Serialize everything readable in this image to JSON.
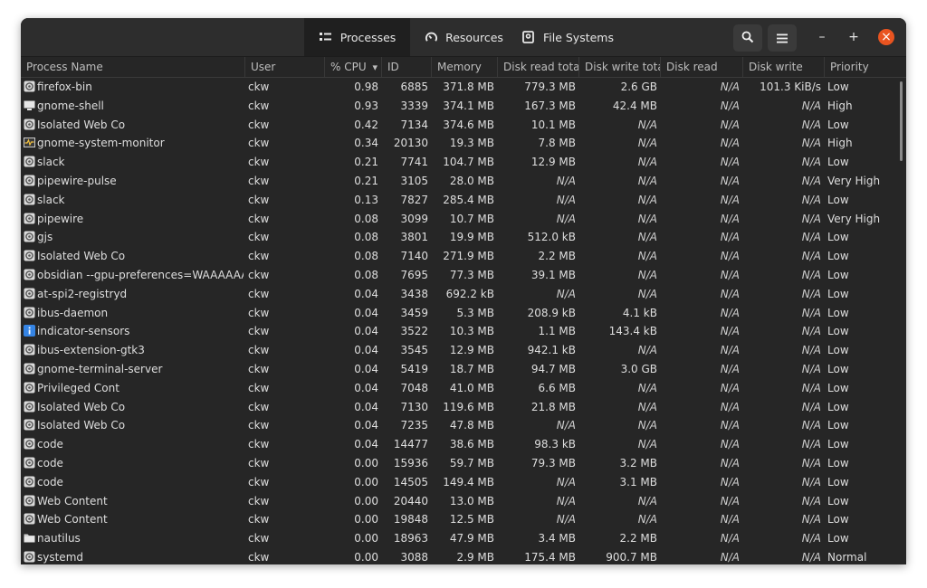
{
  "tabs": [
    {
      "label": "Processes",
      "icon": "list-icon",
      "active": true
    },
    {
      "label": "Resources",
      "icon": "gauge-icon",
      "active": false
    },
    {
      "label": "File Systems",
      "icon": "disk-icon",
      "active": false
    }
  ],
  "header_buttons": {
    "search": "search-icon",
    "menu": "hamburger-menu-icon",
    "minimize": "–",
    "maximize": "+",
    "close": "×"
  },
  "colors": {
    "accent_close": "#e95420",
    "background": "#262626",
    "header": "#2d2d2d"
  },
  "columns": [
    "Process Name",
    "User",
    "% CPU",
    "ID",
    "Memory",
    "Disk read total",
    "Disk write total",
    "Disk read",
    "Disk write",
    "Priority"
  ],
  "sort_indicator": "▾",
  "processes": [
    {
      "name": "firefox-bin",
      "icon": "generic",
      "user": "ckw",
      "cpu": "0.98",
      "id": "6885",
      "memory": "371.8 MB",
      "read_total": "779.3 MB",
      "write_total": "2.6 GB",
      "read": "N/A",
      "write": "101.3 KiB/s",
      "priority": "Low"
    },
    {
      "name": "gnome-shell",
      "icon": "shell",
      "user": "ckw",
      "cpu": "0.93",
      "id": "3339",
      "memory": "374.1 MB",
      "read_total": "167.3 MB",
      "write_total": "42.4 MB",
      "read": "N/A",
      "write": "N/A",
      "priority": "High"
    },
    {
      "name": "Isolated Web Co",
      "icon": "generic",
      "user": "ckw",
      "cpu": "0.42",
      "id": "7134",
      "memory": "374.6 MB",
      "read_total": "10.1 MB",
      "write_total": "N/A",
      "read": "N/A",
      "write": "N/A",
      "priority": "Low"
    },
    {
      "name": "gnome-system-monitor",
      "icon": "monitor",
      "user": "ckw",
      "cpu": "0.34",
      "id": "20130",
      "memory": "19.3 MB",
      "read_total": "7.8 MB",
      "write_total": "N/A",
      "read": "N/A",
      "write": "N/A",
      "priority": "High"
    },
    {
      "name": "slack",
      "icon": "generic",
      "user": "ckw",
      "cpu": "0.21",
      "id": "7741",
      "memory": "104.7 MB",
      "read_total": "12.9 MB",
      "write_total": "N/A",
      "read": "N/A",
      "write": "N/A",
      "priority": "Low"
    },
    {
      "name": "pipewire-pulse",
      "icon": "generic",
      "user": "ckw",
      "cpu": "0.21",
      "id": "3105",
      "memory": "28.0 MB",
      "read_total": "N/A",
      "write_total": "N/A",
      "read": "N/A",
      "write": "N/A",
      "priority": "Very High"
    },
    {
      "name": "slack",
      "icon": "generic",
      "user": "ckw",
      "cpu": "0.13",
      "id": "7827",
      "memory": "285.4 MB",
      "read_total": "N/A",
      "write_total": "N/A",
      "read": "N/A",
      "write": "N/A",
      "priority": "Low"
    },
    {
      "name": "pipewire",
      "icon": "generic",
      "user": "ckw",
      "cpu": "0.08",
      "id": "3099",
      "memory": "10.7 MB",
      "read_total": "N/A",
      "write_total": "N/A",
      "read": "N/A",
      "write": "N/A",
      "priority": "Very High"
    },
    {
      "name": "gjs",
      "icon": "generic",
      "user": "ckw",
      "cpu": "0.08",
      "id": "3801",
      "memory": "19.9 MB",
      "read_total": "512.0 kB",
      "write_total": "N/A",
      "read": "N/A",
      "write": "N/A",
      "priority": "Low"
    },
    {
      "name": "Isolated Web Co",
      "icon": "generic",
      "user": "ckw",
      "cpu": "0.08",
      "id": "7140",
      "memory": "271.9 MB",
      "read_total": "2.2 MB",
      "write_total": "N/A",
      "read": "N/A",
      "write": "N/A",
      "priority": "Low"
    },
    {
      "name": "obsidian --gpu-preferences=WAAAAAAAAAA",
      "icon": "generic",
      "user": "ckw",
      "cpu": "0.08",
      "id": "7695",
      "memory": "77.3 MB",
      "read_total": "39.1 MB",
      "write_total": "N/A",
      "read": "N/A",
      "write": "N/A",
      "priority": "Low"
    },
    {
      "name": "at-spi2-registryd",
      "icon": "generic",
      "user": "ckw",
      "cpu": "0.04",
      "id": "3438",
      "memory": "692.2 kB",
      "read_total": "N/A",
      "write_total": "N/A",
      "read": "N/A",
      "write": "N/A",
      "priority": "Low"
    },
    {
      "name": "ibus-daemon",
      "icon": "generic",
      "user": "ckw",
      "cpu": "0.04",
      "id": "3459",
      "memory": "5.3 MB",
      "read_total": "208.9 kB",
      "write_total": "4.1 kB",
      "read": "N/A",
      "write": "N/A",
      "priority": "Low"
    },
    {
      "name": "indicator-sensors",
      "icon": "info",
      "user": "ckw",
      "cpu": "0.04",
      "id": "3522",
      "memory": "10.3 MB",
      "read_total": "1.1 MB",
      "write_total": "143.4 kB",
      "read": "N/A",
      "write": "N/A",
      "priority": "Low"
    },
    {
      "name": "ibus-extension-gtk3",
      "icon": "generic",
      "user": "ckw",
      "cpu": "0.04",
      "id": "3545",
      "memory": "12.9 MB",
      "read_total": "942.1 kB",
      "write_total": "N/A",
      "read": "N/A",
      "write": "N/A",
      "priority": "Low"
    },
    {
      "name": "gnome-terminal-server",
      "icon": "generic",
      "user": "ckw",
      "cpu": "0.04",
      "id": "5419",
      "memory": "18.7 MB",
      "read_total": "94.7 MB",
      "write_total": "3.0 GB",
      "read": "N/A",
      "write": "N/A",
      "priority": "Low"
    },
    {
      "name": "Privileged Cont",
      "icon": "generic",
      "user": "ckw",
      "cpu": "0.04",
      "id": "7048",
      "memory": "41.0 MB",
      "read_total": "6.6 MB",
      "write_total": "N/A",
      "read": "N/A",
      "write": "N/A",
      "priority": "Low"
    },
    {
      "name": "Isolated Web Co",
      "icon": "generic",
      "user": "ckw",
      "cpu": "0.04",
      "id": "7130",
      "memory": "119.6 MB",
      "read_total": "21.8 MB",
      "write_total": "N/A",
      "read": "N/A",
      "write": "N/A",
      "priority": "Low"
    },
    {
      "name": "Isolated Web Co",
      "icon": "generic",
      "user": "ckw",
      "cpu": "0.04",
      "id": "7235",
      "memory": "47.8 MB",
      "read_total": "N/A",
      "write_total": "N/A",
      "read": "N/A",
      "write": "N/A",
      "priority": "Low"
    },
    {
      "name": "code",
      "icon": "generic",
      "user": "ckw",
      "cpu": "0.04",
      "id": "14477",
      "memory": "38.6 MB",
      "read_total": "98.3 kB",
      "write_total": "N/A",
      "read": "N/A",
      "write": "N/A",
      "priority": "Low"
    },
    {
      "name": "code",
      "icon": "generic",
      "user": "ckw",
      "cpu": "0.00",
      "id": "15936",
      "memory": "59.7 MB",
      "read_total": "79.3 MB",
      "write_total": "3.2 MB",
      "read": "N/A",
      "write": "N/A",
      "priority": "Low"
    },
    {
      "name": "code",
      "icon": "generic",
      "user": "ckw",
      "cpu": "0.00",
      "id": "14505",
      "memory": "149.4 MB",
      "read_total": "N/A",
      "write_total": "3.1 MB",
      "read": "N/A",
      "write": "N/A",
      "priority": "Low"
    },
    {
      "name": "Web Content",
      "icon": "generic",
      "user": "ckw",
      "cpu": "0.00",
      "id": "20440",
      "memory": "13.0 MB",
      "read_total": "N/A",
      "write_total": "N/A",
      "read": "N/A",
      "write": "N/A",
      "priority": "Low"
    },
    {
      "name": "Web Content",
      "icon": "generic",
      "user": "ckw",
      "cpu": "0.00",
      "id": "19848",
      "memory": "12.5 MB",
      "read_total": "N/A",
      "write_total": "N/A",
      "read": "N/A",
      "write": "N/A",
      "priority": "Low"
    },
    {
      "name": "nautilus",
      "icon": "folder",
      "user": "ckw",
      "cpu": "0.00",
      "id": "18963",
      "memory": "47.9 MB",
      "read_total": "3.4 MB",
      "write_total": "2.2 MB",
      "read": "N/A",
      "write": "N/A",
      "priority": "Low"
    },
    {
      "name": "systemd",
      "icon": "generic",
      "user": "ckw",
      "cpu": "0.00",
      "id": "3088",
      "memory": "2.9 MB",
      "read_total": "175.4 MB",
      "write_total": "900.7 MB",
      "read": "N/A",
      "write": "N/A",
      "priority": "Normal"
    }
  ]
}
